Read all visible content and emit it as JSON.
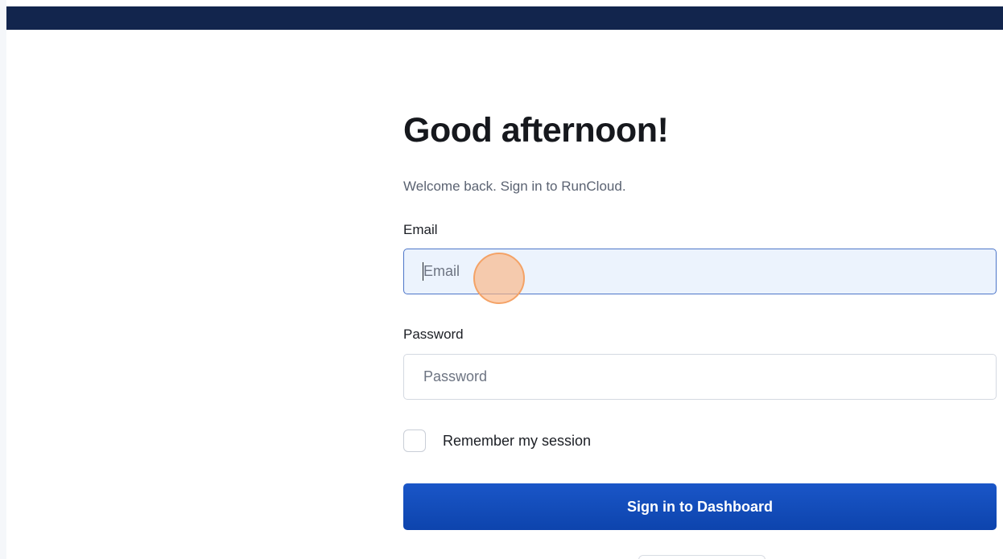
{
  "header": {
    "bar_color": "#12254d"
  },
  "login": {
    "title": "Good afternoon!",
    "subtitle": "Welcome back. Sign in to RunCloud.",
    "email_label": "Email",
    "email_placeholder": "Email",
    "email_value": "",
    "password_label": "Password",
    "password_placeholder": "Password",
    "password_value": "",
    "remember_label": "Remember my session",
    "remember_checked": false,
    "submit_label": "Sign in to Dashboard"
  },
  "colors": {
    "primary_button": "#1550bd",
    "focused_input_background": "#ecf3fd",
    "focused_input_border": "#4d76c9"
  }
}
